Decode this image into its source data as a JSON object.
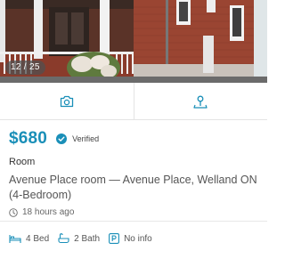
{
  "gallery": {
    "counter": "12 / 25",
    "icons": [
      "photo-house",
      "camera-icon",
      "map-pin-icon"
    ]
  },
  "listing": {
    "price": "$680",
    "verified_label": "Verified",
    "type": "Room",
    "title": "Avenue Place room — Avenue Place, Welland ON (4-Bedroom)",
    "posted": "18 hours ago"
  },
  "features": {
    "bed": "4 Bed",
    "bath": "2 Bath",
    "parking": "No info"
  },
  "colors": {
    "accent": "#1a8fb8",
    "text": "#555555",
    "divider": "#e4e4e4"
  }
}
